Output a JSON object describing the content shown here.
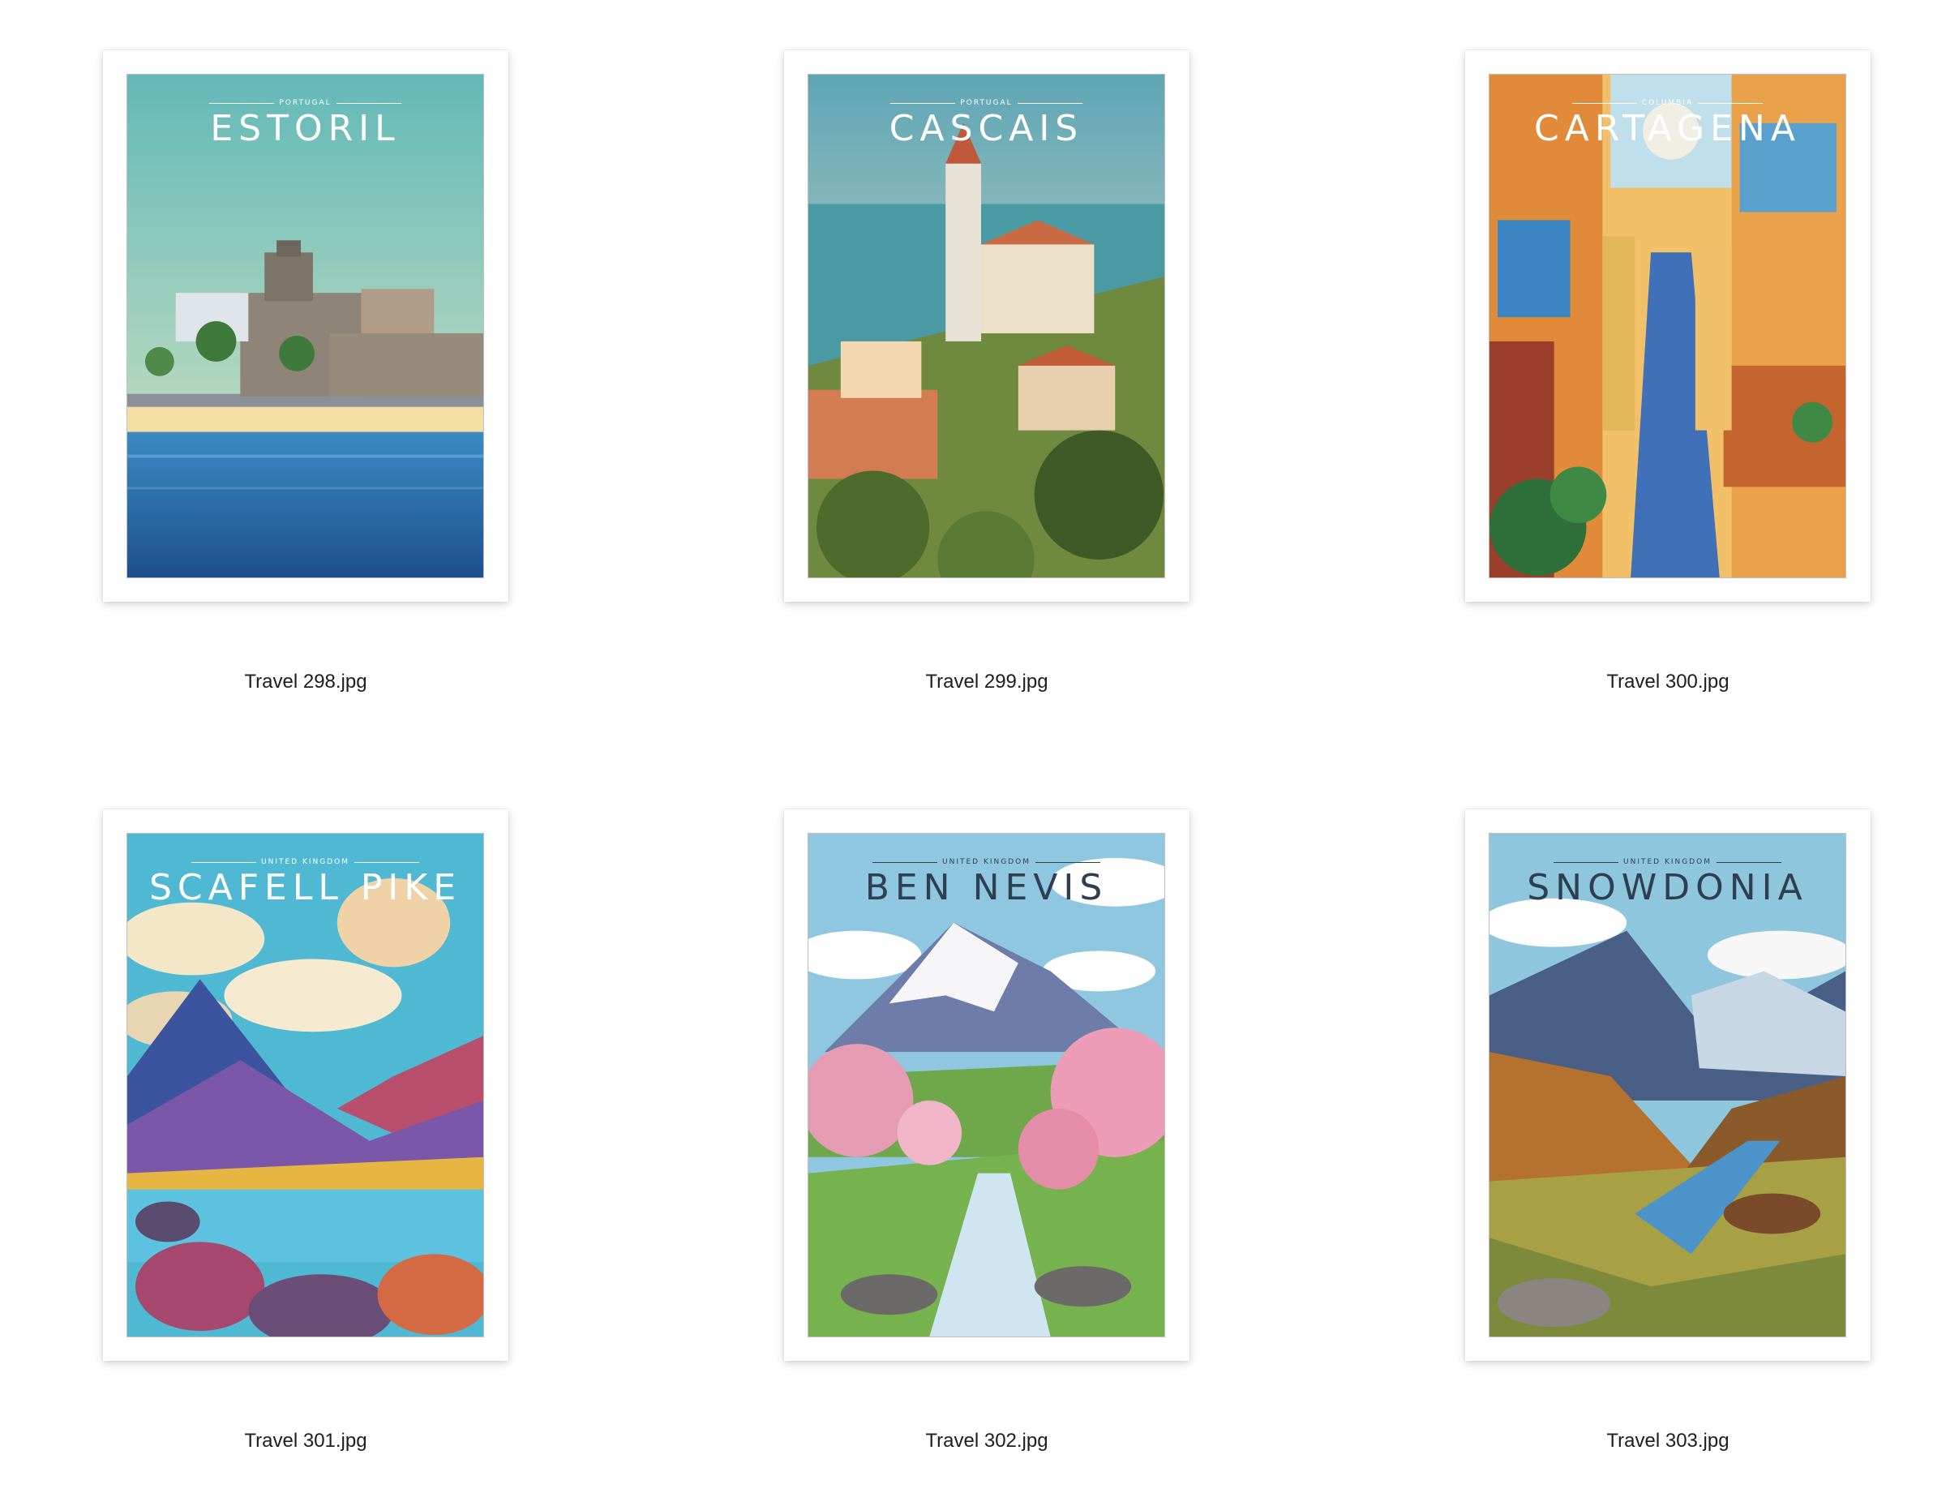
{
  "files": [
    {
      "name": "Travel 298.jpg",
      "poster": {
        "country": "PORTUGAL",
        "title": "ESTORIL",
        "scene": "coastal-castle-beach"
      }
    },
    {
      "name": "Travel 299.jpg",
      "poster": {
        "country": "PORTUGAL",
        "title": "CASCAIS",
        "scene": "church-tower-harbor"
      }
    },
    {
      "name": "Travel 300.jpg",
      "poster": {
        "country": "COLUMBIA",
        "title": "CARTAGENA",
        "scene": "colorful-balcony-street"
      }
    },
    {
      "name": "Travel 301.jpg",
      "poster": {
        "country": "UNITED KINGDOM",
        "title": "SCAFELL PIKE",
        "scene": "mountain-lake-rocks"
      }
    },
    {
      "name": "Travel 302.jpg",
      "poster": {
        "country": "UNITED KINGDOM",
        "title": "BEN NEVIS",
        "scene": "snow-peak-cherry-blossom"
      }
    },
    {
      "name": "Travel 303.jpg",
      "poster": {
        "country": "UNITED KINGDOM",
        "title": "SNOWDONIA",
        "scene": "valley-river-peaks"
      }
    }
  ],
  "colors": {
    "background": "#ffffff",
    "label": "#1d1d1f"
  }
}
